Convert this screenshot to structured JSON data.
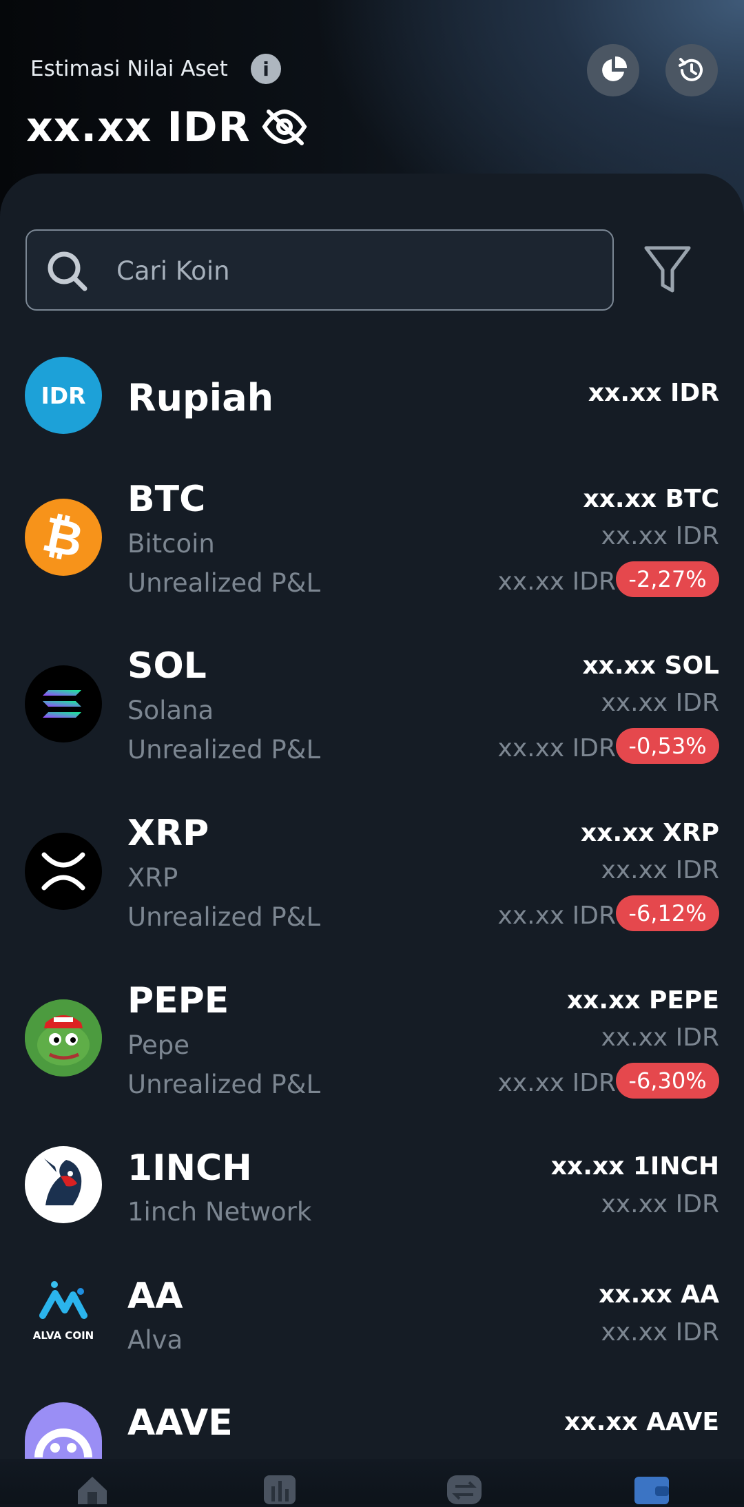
{
  "header": {
    "title": "Estimasi Nilai Aset",
    "total_value": "xx.xx IDR"
  },
  "search": {
    "placeholder": "Cari Koin"
  },
  "rupiah": {
    "name": "Rupiah",
    "logo_text": "IDR",
    "amount": "xx.xx IDR"
  },
  "coins": [
    {
      "symbol": "BTC",
      "name": "Bitcoin",
      "amount": "xx.xx BTC",
      "idr": "xx.xx IDR",
      "pnl_label": "Unrealized P&L",
      "pnl_value": "xx.xx IDR",
      "pnl_percent": "-2,27%"
    },
    {
      "symbol": "SOL",
      "name": "Solana",
      "amount": "xx.xx SOL",
      "idr": "xx.xx IDR",
      "pnl_label": "Unrealized P&L",
      "pnl_value": "xx.xx IDR",
      "pnl_percent": "-0,53%"
    },
    {
      "symbol": "XRP",
      "name": "XRP",
      "amount": "xx.xx XRP",
      "idr": "xx.xx IDR",
      "pnl_label": "Unrealized P&L",
      "pnl_value": "xx.xx IDR",
      "pnl_percent": "-6,12%"
    },
    {
      "symbol": "PEPE",
      "name": "Pepe",
      "amount": "xx.xx PEPE",
      "idr": "xx.xx IDR",
      "pnl_label": "Unrealized P&L",
      "pnl_value": "xx.xx IDR",
      "pnl_percent": "-6,30%"
    },
    {
      "symbol": "1INCH",
      "name": "1inch Network",
      "amount": "xx.xx 1INCH",
      "idr": "xx.xx IDR"
    },
    {
      "symbol": "AA",
      "name": "Alva",
      "amount": "xx.xx AA",
      "idr": "xx.xx IDR",
      "logo_text": "ALVA COIN"
    },
    {
      "symbol": "AAVE",
      "amount": "xx.xx AAVE"
    }
  ],
  "icons": {
    "info": "info-icon",
    "visibility": "eye-off-icon",
    "portfolio": "pie-chart-icon",
    "history": "history-icon",
    "search": "search-icon",
    "filter": "filter-icon",
    "nav": [
      "home-icon",
      "market-icon",
      "trade-icon",
      "wallet-icon"
    ]
  },
  "colors": {
    "negative": "#e5484d",
    "background": "#151c25",
    "muted_text": "#7c8691"
  }
}
